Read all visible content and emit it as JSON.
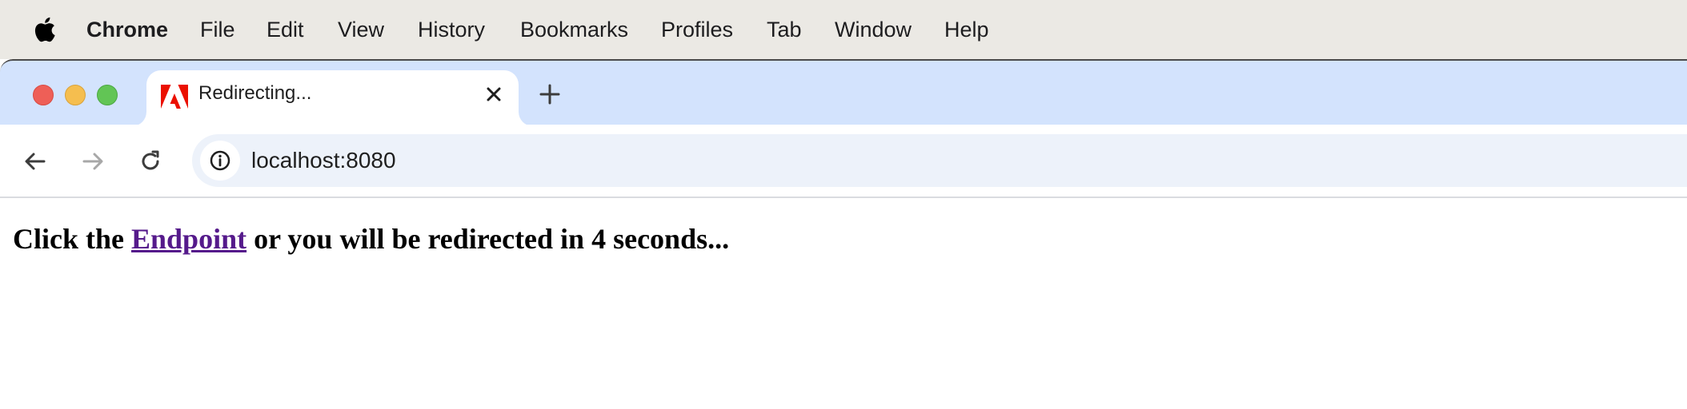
{
  "menubar": {
    "app_name": "Chrome",
    "items": [
      "File",
      "Edit",
      "View",
      "History",
      "Bookmarks",
      "Profiles",
      "Tab",
      "Window",
      "Help"
    ]
  },
  "tab": {
    "title": "Redirecting...",
    "favicon": "adobe-logo-icon"
  },
  "toolbar": {
    "url": "localhost:8080"
  },
  "page": {
    "prefix": "Click the ",
    "link_text": "Endpoint",
    "suffix": " or you will be redirected in 4 seconds..."
  },
  "colors": {
    "tabstrip": "#d3e3fd",
    "link_visited": "#551a8b",
    "omnibox": "#edf2fa"
  }
}
